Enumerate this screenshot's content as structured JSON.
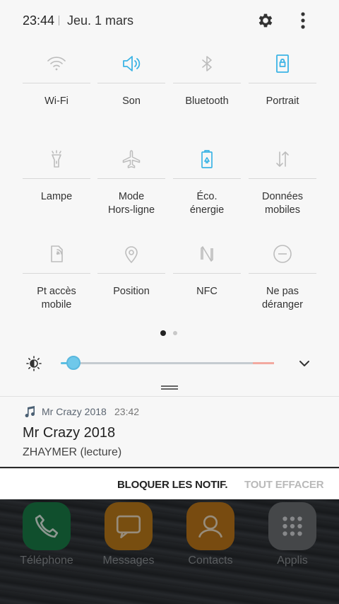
{
  "status": {
    "time": "23:44",
    "date": "Jeu. 1 mars"
  },
  "tiles": [
    {
      "label": "Wi-Fi",
      "icon": "wifi-icon",
      "active": false
    },
    {
      "label": "Son",
      "icon": "sound-icon",
      "active": true
    },
    {
      "label": "Bluetooth",
      "icon": "bluetooth-icon",
      "active": false
    },
    {
      "label": "Portrait",
      "icon": "portrait-lock-icon",
      "active": true
    },
    {
      "label": "Lampe",
      "icon": "flashlight-icon",
      "active": false
    },
    {
      "label": "Mode\nHors-ligne",
      "icon": "airplane-icon",
      "active": false
    },
    {
      "label": "Éco.\nénergie",
      "icon": "battery-saver-icon",
      "active": true
    },
    {
      "label": "Données\nmobiles",
      "icon": "mobile-data-icon",
      "active": false
    },
    {
      "label": "Pt accès\nmobile",
      "icon": "hotspot-icon",
      "active": false
    },
    {
      "label": "Position",
      "icon": "location-icon",
      "active": false
    },
    {
      "label": "NFC",
      "icon": "nfc-icon",
      "active": false
    },
    {
      "label": "Ne pas\ndéranger",
      "icon": "do-not-disturb-icon",
      "active": false
    }
  ],
  "brightness": {
    "level": 0.06
  },
  "notification": {
    "app_name": "Mr Crazy 2018",
    "time": "23:42",
    "title": "Mr Crazy 2018",
    "subtitle": "ZHAYMER (lecture)"
  },
  "actions": {
    "block": "BLOQUER LES NOTIF.",
    "clear": "TOUT EFFACER"
  },
  "home_apps": [
    {
      "label": "Téléphone",
      "icon": "phone-icon",
      "color": "#1a7a45"
    },
    {
      "label": "Messages",
      "icon": "messages-icon",
      "color": "#b8791a"
    },
    {
      "label": "Contacts",
      "icon": "contacts-icon",
      "color": "#b8741a"
    },
    {
      "label": "Applis",
      "icon": "apps-grid-icon",
      "color": "#6a6d71"
    }
  ],
  "colors": {
    "accent": "#3cb4e5",
    "inactive_icon": "#b9b9b9"
  }
}
